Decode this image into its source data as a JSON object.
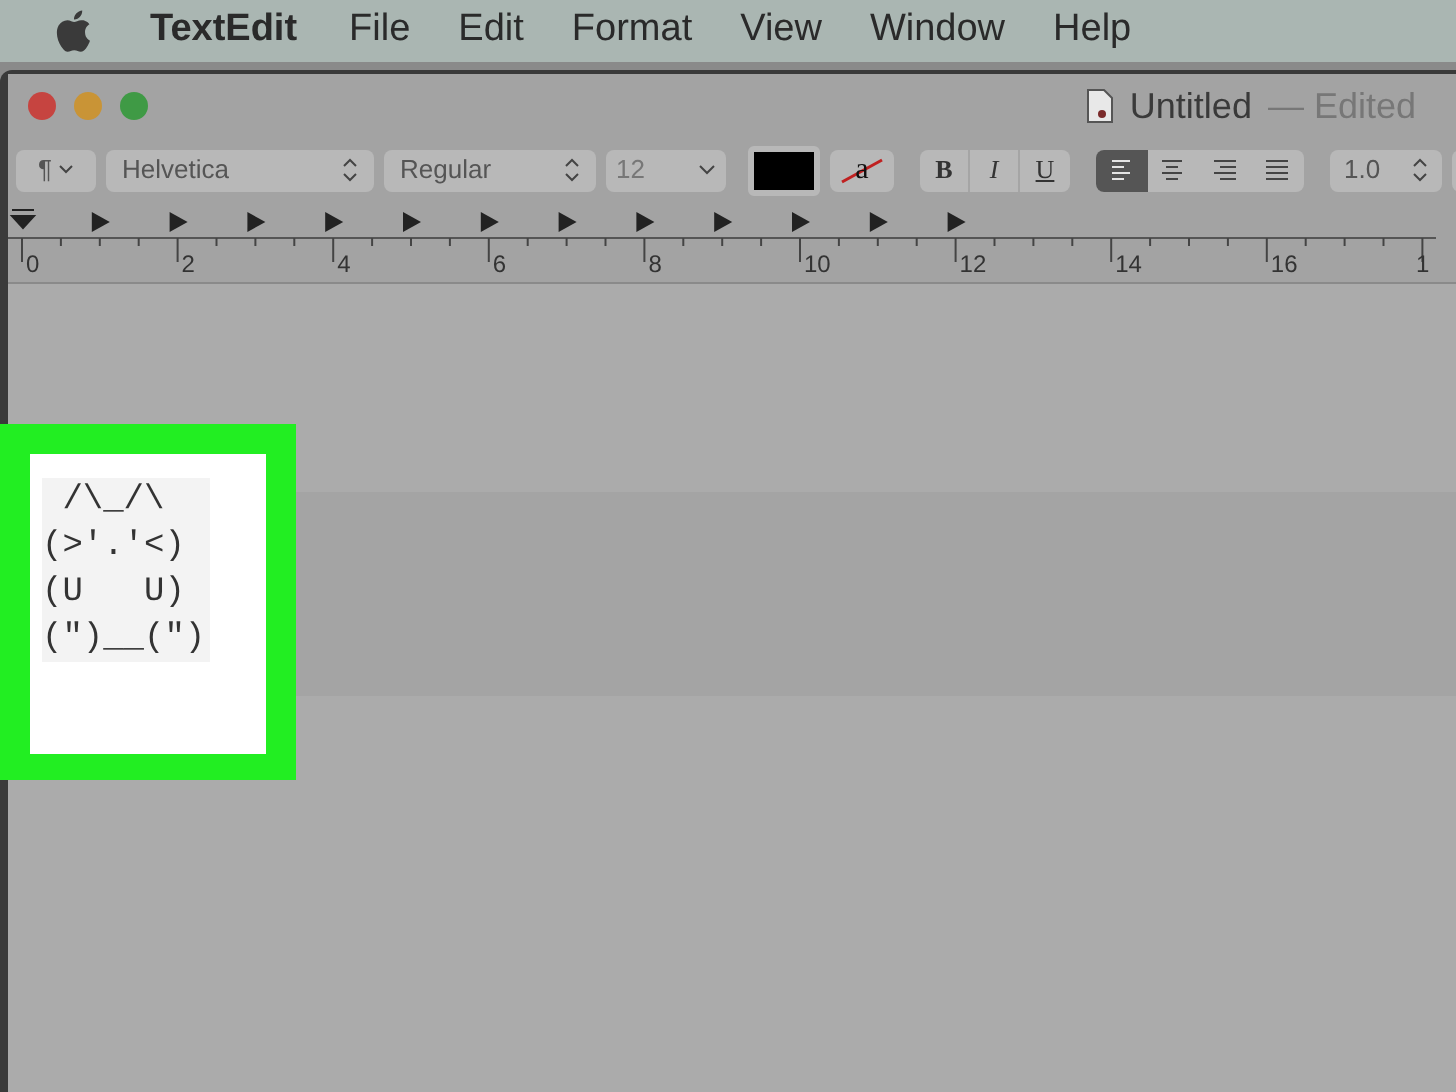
{
  "menu_bar": {
    "app_name": "TextEdit",
    "items": [
      "File",
      "Edit",
      "Format",
      "View",
      "Window",
      "Help"
    ]
  },
  "window": {
    "title": "Untitled",
    "status": "— Edited"
  },
  "toolbar": {
    "paragraph_style": "¶",
    "font": "Helvetica",
    "typeface": "Regular",
    "size": "12",
    "styles": [
      {
        "label": "B",
        "kind": "bold"
      },
      {
        "label": "I",
        "kind": "italic"
      },
      {
        "label": "U",
        "kind": "underline"
      }
    ],
    "alignment": [
      {
        "kind": "left",
        "selected": true
      },
      {
        "kind": "center",
        "selected": false
      },
      {
        "kind": "right",
        "selected": false
      },
      {
        "kind": "justify",
        "selected": false
      }
    ],
    "line_spacing": "1.0",
    "background_color_label": "a"
  },
  "ruler": {
    "labels": [
      "0",
      "2",
      "4",
      "6",
      "8",
      "10",
      "12",
      "14",
      "16",
      "1"
    ]
  },
  "document": {
    "highlighted_text": [
      " /\\_/\\",
      "(>'.'<)",
      "(U   U)",
      "(\")__(\")"
    ]
  }
}
